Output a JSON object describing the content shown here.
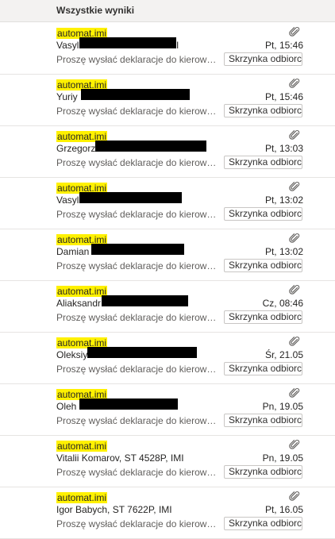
{
  "header": {
    "title": "Wszystkie wyniki"
  },
  "messages": [
    {
      "from": "automat.imi",
      "sender": "Vasyl",
      "sender_suffix": "I",
      "date": "Pt, 15:46",
      "preview": "Proszę wysłać deklaracje do kierownika budowy",
      "folder": "Skrzynka odbiorcza",
      "redacted": true
    },
    {
      "from": "automat.imi",
      "sender": "Yuriy",
      "sender_suffix": "",
      "date": "Pt, 15:46",
      "preview": "Proszę wysłać deklaracje do kierownika budowy",
      "folder": "Skrzynka odbiorcza",
      "redacted": true
    },
    {
      "from": "automat.imi",
      "sender": "Grzegorz",
      "sender_suffix": "",
      "date": "Pt, 13:03",
      "preview": "Proszę wysłać deklaracje do kierownika budowy",
      "folder": "Skrzynka odbiorcza",
      "redacted": true
    },
    {
      "from": "automat.imi",
      "sender": "Vasyl",
      "sender_suffix": "",
      "date": "Pt, 13:02",
      "preview": "Proszę wysłać deklaracje do kierownika budowy",
      "folder": "Skrzynka odbiorcza",
      "redacted": true
    },
    {
      "from": "automat.imi",
      "sender": "Damian",
      "sender_suffix": "",
      "date": "Pt, 13:02",
      "preview": "Proszę wysłać deklaracje do kierownika budowy",
      "folder": "Skrzynka odbiorcza",
      "redacted": true
    },
    {
      "from": "automat.imi",
      "sender": "Aliaksandr",
      "sender_suffix": "",
      "date": "Cz, 08:46",
      "preview": "Proszę wysłać deklaracje do kierownika budowy",
      "folder": "Skrzynka odbiorcza",
      "redacted": true
    },
    {
      "from": "automat.imi",
      "sender": "Oleksiy",
      "sender_suffix": "",
      "date": "Śr, 21.05",
      "preview": "Proszę wysłać deklaracje do kierownika budowy",
      "folder": "Skrzynka odbiorcza",
      "redacted": true
    },
    {
      "from": "automat.imi",
      "sender": "Oleh",
      "sender_suffix": "",
      "date": "Pn, 19.05",
      "preview": "Proszę wysłać deklaracje do kierownika budowy",
      "folder": "Skrzynka odbiorcza",
      "redacted": true
    },
    {
      "from": "automat.imi",
      "sender": "Vitalii Komarov, ST 4528P, IMI",
      "sender_suffix": "",
      "date": "Pn, 19.05",
      "preview": "Proszę wysłać deklaracje do kierownika budowy",
      "folder": "Skrzynka odbiorcza",
      "redacted": false
    },
    {
      "from": "automat.imi",
      "sender": "Igor Babych, ST 7622P, IMI",
      "sender_suffix": "",
      "date": "Pt, 16.05",
      "preview": "Proszę wysłać deklaracje do kierownika budowy",
      "folder": "Skrzynka odbiorcza",
      "redacted": false
    }
  ],
  "icons": {
    "attachment": "paperclip-icon"
  },
  "colors": {
    "highlight": "#fff100",
    "redaction": "#000000",
    "header_bg": "#f3f2f1"
  }
}
